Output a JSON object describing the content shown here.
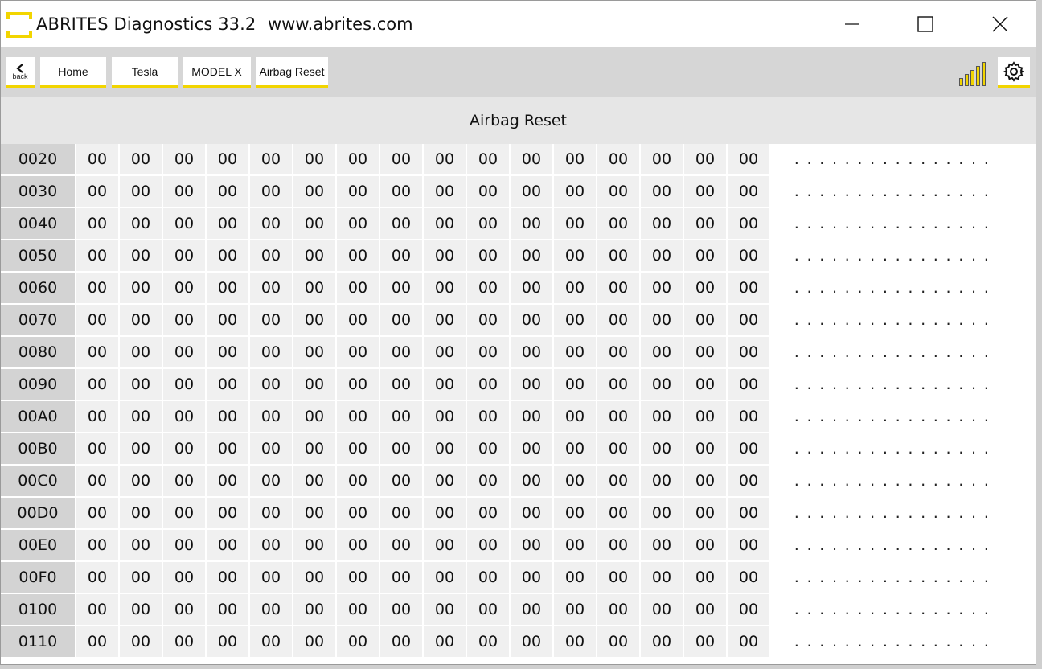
{
  "window": {
    "title": "ABRITES Diagnostics 33.2",
    "url": "www.abrites.com",
    "controls": [
      "minimize",
      "maximize",
      "close"
    ]
  },
  "toolbar": {
    "back_label": "back",
    "breadcrumbs": [
      "Home",
      "Tesla",
      "MODEL X",
      "Airbag Reset"
    ],
    "signal_icon": "signal-strength-icon",
    "settings_icon": "gear-icon"
  },
  "page": {
    "title": "Airbag Reset"
  },
  "colors": {
    "accent": "#f2d500",
    "toolbar_bg": "#d6d6d6",
    "header_bg": "#e6e6e6",
    "address_bg": "#d3d3d3",
    "cell_bg": "#f0f0f0"
  },
  "hex_dump": {
    "rows": [
      {
        "address": "0020",
        "bytes": [
          "00",
          "00",
          "00",
          "00",
          "00",
          "00",
          "00",
          "00",
          "00",
          "00",
          "00",
          "00",
          "00",
          "00",
          "00",
          "00"
        ],
        "ascii": "................"
      },
      {
        "address": "0030",
        "bytes": [
          "00",
          "00",
          "00",
          "00",
          "00",
          "00",
          "00",
          "00",
          "00",
          "00",
          "00",
          "00",
          "00",
          "00",
          "00",
          "00"
        ],
        "ascii": "................"
      },
      {
        "address": "0040",
        "bytes": [
          "00",
          "00",
          "00",
          "00",
          "00",
          "00",
          "00",
          "00",
          "00",
          "00",
          "00",
          "00",
          "00",
          "00",
          "00",
          "00"
        ],
        "ascii": "................"
      },
      {
        "address": "0050",
        "bytes": [
          "00",
          "00",
          "00",
          "00",
          "00",
          "00",
          "00",
          "00",
          "00",
          "00",
          "00",
          "00",
          "00",
          "00",
          "00",
          "00"
        ],
        "ascii": "................"
      },
      {
        "address": "0060",
        "bytes": [
          "00",
          "00",
          "00",
          "00",
          "00",
          "00",
          "00",
          "00",
          "00",
          "00",
          "00",
          "00",
          "00",
          "00",
          "00",
          "00"
        ],
        "ascii": "................"
      },
      {
        "address": "0070",
        "bytes": [
          "00",
          "00",
          "00",
          "00",
          "00",
          "00",
          "00",
          "00",
          "00",
          "00",
          "00",
          "00",
          "00",
          "00",
          "00",
          "00"
        ],
        "ascii": "................"
      },
      {
        "address": "0080",
        "bytes": [
          "00",
          "00",
          "00",
          "00",
          "00",
          "00",
          "00",
          "00",
          "00",
          "00",
          "00",
          "00",
          "00",
          "00",
          "00",
          "00"
        ],
        "ascii": "................"
      },
      {
        "address": "0090",
        "bytes": [
          "00",
          "00",
          "00",
          "00",
          "00",
          "00",
          "00",
          "00",
          "00",
          "00",
          "00",
          "00",
          "00",
          "00",
          "00",
          "00"
        ],
        "ascii": "................"
      },
      {
        "address": "00A0",
        "bytes": [
          "00",
          "00",
          "00",
          "00",
          "00",
          "00",
          "00",
          "00",
          "00",
          "00",
          "00",
          "00",
          "00",
          "00",
          "00",
          "00"
        ],
        "ascii": "................"
      },
      {
        "address": "00B0",
        "bytes": [
          "00",
          "00",
          "00",
          "00",
          "00",
          "00",
          "00",
          "00",
          "00",
          "00",
          "00",
          "00",
          "00",
          "00",
          "00",
          "00"
        ],
        "ascii": "................"
      },
      {
        "address": "00C0",
        "bytes": [
          "00",
          "00",
          "00",
          "00",
          "00",
          "00",
          "00",
          "00",
          "00",
          "00",
          "00",
          "00",
          "00",
          "00",
          "00",
          "00"
        ],
        "ascii": "................"
      },
      {
        "address": "00D0",
        "bytes": [
          "00",
          "00",
          "00",
          "00",
          "00",
          "00",
          "00",
          "00",
          "00",
          "00",
          "00",
          "00",
          "00",
          "00",
          "00",
          "00"
        ],
        "ascii": "................"
      },
      {
        "address": "00E0",
        "bytes": [
          "00",
          "00",
          "00",
          "00",
          "00",
          "00",
          "00",
          "00",
          "00",
          "00",
          "00",
          "00",
          "00",
          "00",
          "00",
          "00"
        ],
        "ascii": "................"
      },
      {
        "address": "00F0",
        "bytes": [
          "00",
          "00",
          "00",
          "00",
          "00",
          "00",
          "00",
          "00",
          "00",
          "00",
          "00",
          "00",
          "00",
          "00",
          "00",
          "00"
        ],
        "ascii": "................"
      },
      {
        "address": "0100",
        "bytes": [
          "00",
          "00",
          "00",
          "00",
          "00",
          "00",
          "00",
          "00",
          "00",
          "00",
          "00",
          "00",
          "00",
          "00",
          "00",
          "00"
        ],
        "ascii": "................"
      },
      {
        "address": "0110",
        "bytes": [
          "00",
          "00",
          "00",
          "00",
          "00",
          "00",
          "00",
          "00",
          "00",
          "00",
          "00",
          "00",
          "00",
          "00",
          "00",
          "00"
        ],
        "ascii": "................"
      }
    ]
  }
}
